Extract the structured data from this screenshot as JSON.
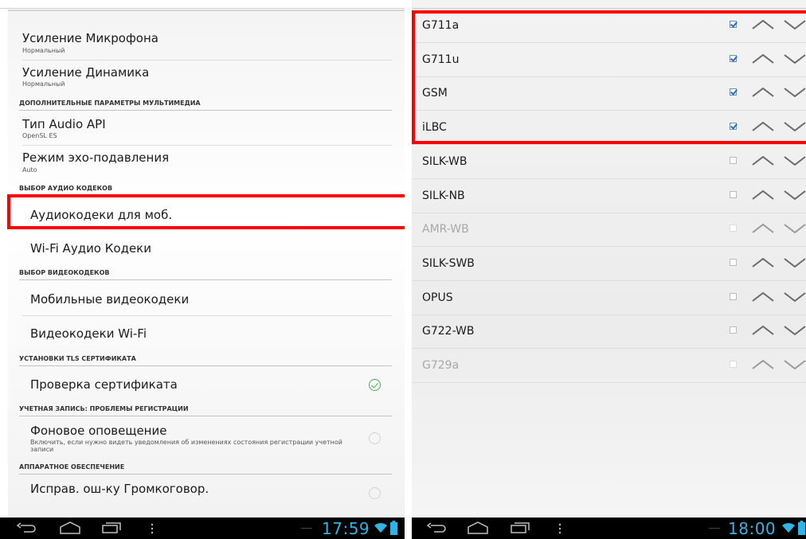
{
  "left": {
    "items": [
      {
        "kind": "pref",
        "title": "Усиление Микрофона",
        "summary": "Нормальный"
      },
      {
        "kind": "pref",
        "title": "Усиление Динамика",
        "summary": "Нормальный"
      },
      {
        "kind": "category",
        "title": "ДОПОЛНИТЕЛЬНЫЕ ПАРАМЕТРЫ МУЛЬТИМЕДИА"
      },
      {
        "kind": "pref",
        "title": "Тип Audio API",
        "summary": "OpenSL ES"
      },
      {
        "kind": "pref",
        "title": "Режим эхо-подавления",
        "summary": "Auto"
      },
      {
        "kind": "category",
        "title": "ВЫБОР АУДИО КОДЕКОВ"
      },
      {
        "kind": "pref",
        "title": "Аудиокодеки для моб.",
        "summary": ""
      },
      {
        "kind": "pref",
        "title": "Wi-Fi Аудио Кодеки",
        "summary": ""
      },
      {
        "kind": "category",
        "title": "ВЫБОР ВИДЕОКОДЕКОВ"
      },
      {
        "kind": "pref",
        "title": "Мобильные видеокодеки",
        "summary": ""
      },
      {
        "kind": "pref",
        "title": "Видеокодеки Wi-Fi",
        "summary": ""
      },
      {
        "kind": "category",
        "title": "УСТАНОВКИ TLS СЕРТИФИКАТА"
      },
      {
        "kind": "pref",
        "title": "Проверка сертификата",
        "summary": "",
        "control": "checked"
      },
      {
        "kind": "category",
        "title": "УЧЕТНАЯ ЗАПИСЬ: ПРОБЛЕМЫ РЕГИСТРАЦИИ"
      },
      {
        "kind": "pref",
        "title": "Фоновое оповещение",
        "summary": "Включить, если нужно видеть уведомления об изменениях состояния регистрации учетной записи",
        "control": "unchecked"
      },
      {
        "kind": "category",
        "title": "АППАРАТНОЕ ОБЕСПЕЧЕНИЕ"
      },
      {
        "kind": "pref",
        "title": "Исправ. ош-ку Громкоговор.",
        "summary": "",
        "control": "unchecked"
      }
    ],
    "highlighted_item": "Аудиокодеки для моб.",
    "clock": "17:59"
  },
  "right": {
    "codecs": [
      {
        "name": "G711a",
        "checked": true,
        "enabled": true
      },
      {
        "name": "G711u",
        "checked": true,
        "enabled": true
      },
      {
        "name": "GSM",
        "checked": true,
        "enabled": true
      },
      {
        "name": "iLBC",
        "checked": true,
        "enabled": true
      },
      {
        "name": "SILK-WB",
        "checked": false,
        "enabled": true
      },
      {
        "name": "SILK-NB",
        "checked": false,
        "enabled": true
      },
      {
        "name": "AMR-WB",
        "checked": false,
        "enabled": false
      },
      {
        "name": "SILK-SWB",
        "checked": false,
        "enabled": true
      },
      {
        "name": "OPUS",
        "checked": false,
        "enabled": true
      },
      {
        "name": "G722-WB",
        "checked": false,
        "enabled": true
      },
      {
        "name": "G729a",
        "checked": false,
        "enabled": false
      }
    ],
    "highlighted_codecs": [
      "G711a",
      "G711u",
      "GSM",
      "iLBC"
    ],
    "clock": "18:00"
  },
  "colors": {
    "accent": "#2fb4e3",
    "highlight": "#ff0000",
    "checked_green": "#4caf50",
    "checkbox_blue": "#2e6db4"
  },
  "icons": [
    "back-icon",
    "home-icon",
    "recent-apps-icon",
    "menu-icon",
    "wifi-icon",
    "battery-icon",
    "move-up-icon",
    "move-down-icon",
    "checkmark-icon"
  ]
}
